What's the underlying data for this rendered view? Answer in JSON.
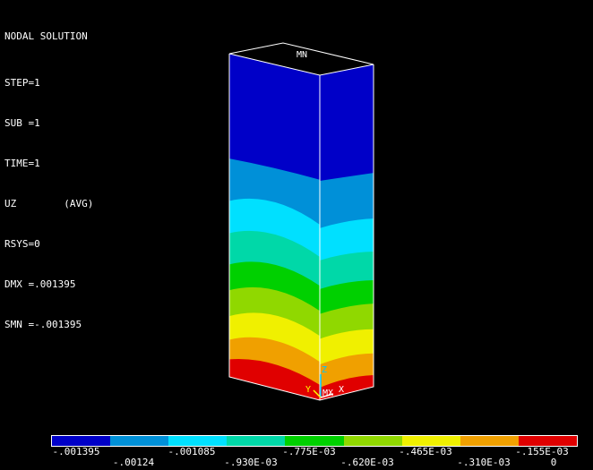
{
  "info": {
    "title": "NODAL SOLUTION",
    "lines": [
      "STEP=1",
      "SUB =1",
      "TIME=1",
      "UZ        (AVG)",
      "RSYS=0",
      "DMX =.001395",
      "SMN =-.001395"
    ]
  },
  "model": {
    "min_label": "MN",
    "max_label": "MX",
    "triad": {
      "z": "Z",
      "y": "Y",
      "x": "X"
    }
  },
  "legend": {
    "colors": [
      "#0000c8",
      "#0090d8",
      "#00e0ff",
      "#00d8a8",
      "#00d000",
      "#90d800",
      "#f0f000",
      "#f0a000",
      "#e00000"
    ],
    "labels": [
      "-.001395",
      "-.00124",
      "-.001085",
      "-.930E-03",
      "-.775E-03",
      "-.620E-03",
      "-.465E-03",
      "-.310E-03",
      "-.155E-03",
      "0"
    ]
  },
  "colors": {
    "background": "#000000",
    "text": "#ffffff",
    "outline": "#ffffff",
    "triad_z": "#00c8ff",
    "triad_y": "#ffff00",
    "triad_x": "#ffffff"
  }
}
